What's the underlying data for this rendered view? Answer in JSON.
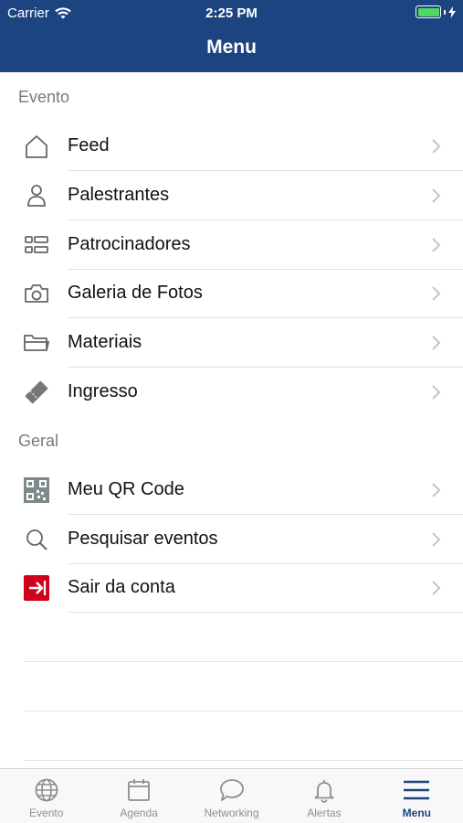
{
  "status_bar": {
    "carrier": "Carrier",
    "time": "2:25 PM",
    "battery_color": "#4cd964"
  },
  "header": {
    "title": "Menu",
    "background": "#1c4480"
  },
  "sections": [
    {
      "title": "Evento",
      "items": [
        {
          "label": "Feed",
          "icon": "home-icon"
        },
        {
          "label": "Palestrantes",
          "icon": "person-icon"
        },
        {
          "label": "Patrocinadores",
          "icon": "list-icon"
        },
        {
          "label": "Galeria de Fotos",
          "icon": "camera-icon"
        },
        {
          "label": "Materiais",
          "icon": "folder-icon"
        },
        {
          "label": "Ingresso",
          "icon": "ticket-icon"
        }
      ]
    },
    {
      "title": "Geral",
      "items": [
        {
          "label": "Meu QR Code",
          "icon": "qr-code-icon"
        },
        {
          "label": "Pesquisar eventos",
          "icon": "search-icon"
        },
        {
          "label": "Sair da conta",
          "icon": "logout-icon",
          "icon_color": "#d0021b"
        }
      ]
    }
  ],
  "tabbar": {
    "active": "Menu",
    "active_color": "#1c4480",
    "tabs": [
      {
        "label": "Evento",
        "icon": "globe-icon"
      },
      {
        "label": "Agenda",
        "icon": "calendar-icon"
      },
      {
        "label": "Networking",
        "icon": "chat-bubble-icon"
      },
      {
        "label": "Alertas",
        "icon": "bell-icon"
      },
      {
        "label": "Menu",
        "icon": "hamburger-menu-icon"
      }
    ]
  }
}
